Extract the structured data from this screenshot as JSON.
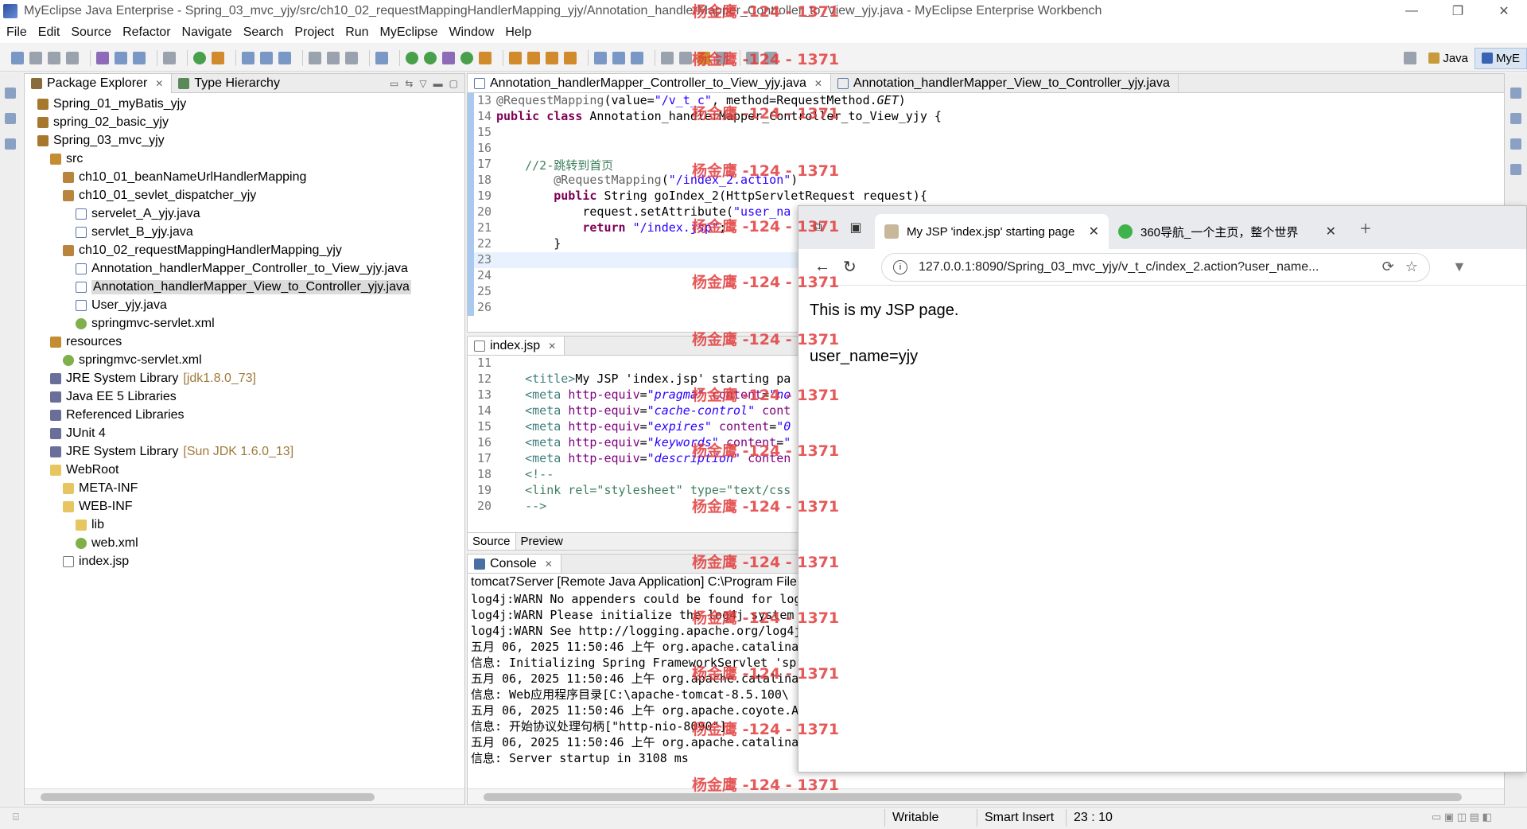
{
  "window": {
    "title": "MyEclipse Java Enterprise - Spring_03_mvc_yjy/src/ch10_02_requestMappingHandlerMapping_yjy/Annotation_handlerMapper_Controller_to_View_yjy.java - MyEclipse Enterprise Workbench",
    "min": "—",
    "max": "❐",
    "close": "✕"
  },
  "menu": [
    "File",
    "Edit",
    "Source",
    "Refactor",
    "Navigate",
    "Search",
    "Project",
    "Run",
    "MyEclipse",
    "Window",
    "Help"
  ],
  "perspectives": {
    "java": "Java",
    "myeclipse": "MyE"
  },
  "package_explorer": {
    "tab_label": "Package Explorer",
    "type_hierarchy_label": "Type Hierarchy",
    "tree": [
      {
        "label": "Spring_01_myBatis_yjy",
        "icon": "project-icon",
        "level": 0
      },
      {
        "label": "spring_02_basic_yjy",
        "icon": "project-icon",
        "level": 0
      },
      {
        "label": "Spring_03_mvc_yjy",
        "icon": "project-icon",
        "level": 0
      },
      {
        "label": "src",
        "icon": "source-folder-icon",
        "level": 1
      },
      {
        "label": "ch10_01_beanNameUrlHandlerMapping",
        "icon": "package-icon",
        "level": 2
      },
      {
        "label": "ch10_01_sevlet_dispatcher_yjy",
        "icon": "package-icon",
        "level": 2
      },
      {
        "label": "servelet_A_yjy.java",
        "icon": "java-file-icon",
        "level": 3
      },
      {
        "label": "servlet_B_yjy.java",
        "icon": "java-file-icon",
        "level": 3
      },
      {
        "label": "ch10_02_requestMappingHandlerMapping_yjy",
        "icon": "package-icon",
        "level": 2
      },
      {
        "label": "Annotation_handlerMapper_Controller_to_View_yjy.java",
        "icon": "java-file-icon",
        "level": 3
      },
      {
        "label": "Annotation_handlerMapper_View_to_Controller_yjy.java",
        "icon": "java-file-icon",
        "level": 3,
        "selected": true
      },
      {
        "label": "User_yjy.java",
        "icon": "java-file-icon",
        "level": 3
      },
      {
        "label": "springmvc-servlet.xml",
        "icon": "xml-file-icon",
        "level": 3
      },
      {
        "label": "resources",
        "icon": "source-folder-icon",
        "level": 1
      },
      {
        "label": "springmvc-servlet.xml",
        "icon": "xml-file-icon",
        "level": 2
      },
      {
        "label": "JRE System Library",
        "deco": "[jdk1.8.0_73]",
        "icon": "library-icon",
        "level": 1
      },
      {
        "label": "Java EE 5 Libraries",
        "icon": "library-icon",
        "level": 1
      },
      {
        "label": "Referenced Libraries",
        "icon": "library-icon",
        "level": 1
      },
      {
        "label": "JUnit 4",
        "icon": "library-icon",
        "level": 1
      },
      {
        "label": "JRE System Library",
        "deco": "[Sun JDK 1.6.0_13]",
        "icon": "library-icon",
        "level": 1
      },
      {
        "label": "WebRoot",
        "icon": "folder-icon",
        "level": 1
      },
      {
        "label": "META-INF",
        "icon": "folder-icon",
        "level": 2
      },
      {
        "label": "WEB-INF",
        "icon": "folder-icon",
        "level": 2
      },
      {
        "label": "lib",
        "icon": "folder-icon",
        "level": 3
      },
      {
        "label": "web.xml",
        "icon": "xml-file-icon",
        "level": 3
      },
      {
        "label": "index.jsp",
        "icon": "jsp-file-icon",
        "level": 2
      }
    ]
  },
  "editor": {
    "tabs": [
      {
        "label": "Annotation_handlerMapper_Controller_to_View_yjy.java",
        "active": true
      },
      {
        "label": "Annotation_handlerMapper_View_to_Controller_yjy.java",
        "active": false
      }
    ],
    "lines": [
      {
        "n": "13",
        "html": "<span class=\"ann\">@RequestMapping</span>(value=<span class=\"str\">\"/v_t_c\"</span>, method=RequestMethod.<i>GET</i>)"
      },
      {
        "n": "14",
        "html": "<span class=\"kw\">public class</span> Annotation_handlerMapper_Controller_to_View_yjy {"
      },
      {
        "n": "15",
        "html": ""
      },
      {
        "n": "16",
        "html": ""
      },
      {
        "n": "17",
        "html": "    <span class=\"cmt\">//2-跳转到首页</span>"
      },
      {
        "n": "18",
        "html": "        <span class=\"ann\">@RequestMapping</span>(<span class=\"str\">\"/index_2.action\"</span>)"
      },
      {
        "n": "19",
        "html": "        <span class=\"kw\">public</span> String goIndex_2(HttpServletRequest request){"
      },
      {
        "n": "20",
        "html": "            request.setAttribute(<span class=\"str\">\"user_na</span>"
      },
      {
        "n": "21",
        "html": "            <span class=\"kw\">return</span> <span class=\"str\">\"/index.jsp\"</span>;"
      },
      {
        "n": "22",
        "html": "        }"
      },
      {
        "n": "23",
        "html": "",
        "current": true
      },
      {
        "n": "24",
        "html": ""
      },
      {
        "n": "25",
        "html": ""
      },
      {
        "n": "26",
        "html": ""
      }
    ]
  },
  "jsp_editor": {
    "tab_label": "index.jsp",
    "lines": [
      {
        "n": "11",
        "html": ""
      },
      {
        "n": "12",
        "html": "    <span class=\"tag\">&lt;title&gt;</span>My JSP 'index.jsp' starting pa"
      },
      {
        "n": "13",
        "html": "    <span class=\"tag\">&lt;meta</span> <span class=\"attr\">http-equiv</span>=<span class=\"attrv\">\"pragma\"</span> <span class=\"attr\">content</span>=<span class=\"attrv\">\"no</span>"
      },
      {
        "n": "14",
        "html": "    <span class=\"tag\">&lt;meta</span> <span class=\"attr\">http-equiv</span>=<span class=\"attrv\">\"cache-control\"</span> <span class=\"attr\">cont</span>"
      },
      {
        "n": "15",
        "html": "    <span class=\"tag\">&lt;meta</span> <span class=\"attr\">http-equiv</span>=<span class=\"attrv\">\"expires\"</span> <span class=\"attr\">content</span>=<span class=\"attrv\">\"0</span>"
      },
      {
        "n": "16",
        "html": "    <span class=\"tag\">&lt;meta</span> <span class=\"attr\">http-equiv</span>=<span class=\"attrv\">\"keywords\"</span> <span class=\"attr\">content</span>=<span class=\"attrv\">\"</span>"
      },
      {
        "n": "17",
        "html": "    <span class=\"tag\">&lt;meta</span> <span class=\"attr\">http-equiv</span>=<span class=\"attrv\">\"description\"</span> <span class=\"attr\">conten</span>"
      },
      {
        "n": "18",
        "html": "    <span class=\"cmt\">&lt;!--</span>"
      },
      {
        "n": "19",
        "html": "    <span class=\"cmt\">&lt;link rel=\"stylesheet\" type=\"text/css</span>"
      },
      {
        "n": "20",
        "html": "    <span class=\"cmt\">--&gt;</span>"
      }
    ],
    "source_tab": "Source",
    "preview_tab": "Preview"
  },
  "console": {
    "tab_label": "Console",
    "header": "tomcat7Server [Remote Java Application] C:\\Program File",
    "lines": [
      "log4j:WARN No appenders could be found for log",
      "log4j:WARN Please initialize the log4j system",
      "log4j:WARN See http://logging.apache.org/log4j",
      "五月 06, 2025 11:50:46 上午 org.apache.catalina",
      "信息: Initializing Spring FrameworkServlet 'sp",
      "五月 06, 2025 11:50:46 上午 org.apache.catalina",
      "信息: Web应用程序目录[C:\\apache-tomcat-8.5.100\\",
      "五月 06, 2025 11:50:46 上午 org.apache.coyote.A",
      "信息: 开始协议处理句柄[\"http-nio-8090\"]",
      "五月 06, 2025 11:50:46 上午 org.apache.catalina",
      "信息: Server startup in 3108 ms"
    ]
  },
  "browser": {
    "tabs": [
      {
        "label": "My JSP 'index.jsp' starting page",
        "active": true
      },
      {
        "label": "360导航_一个主页，整个世界",
        "active": false
      }
    ],
    "url": "127.0.0.1:8090/Spring_03_mvc_yjy/v_t_c/index_2.action?user_name...",
    "content": [
      "This is my JSP page.",
      "user_name=yjy"
    ]
  },
  "status": {
    "writable": "Writable",
    "insert_mode": "Smart Insert",
    "position": "23 : 10"
  },
  "watermark": "杨金鹰 -124 - 1371",
  "colors": {
    "keyword": "#7f0055",
    "string": "#2a00ff",
    "comment": "#3f7f5f",
    "watermark": "#e13c3c"
  }
}
